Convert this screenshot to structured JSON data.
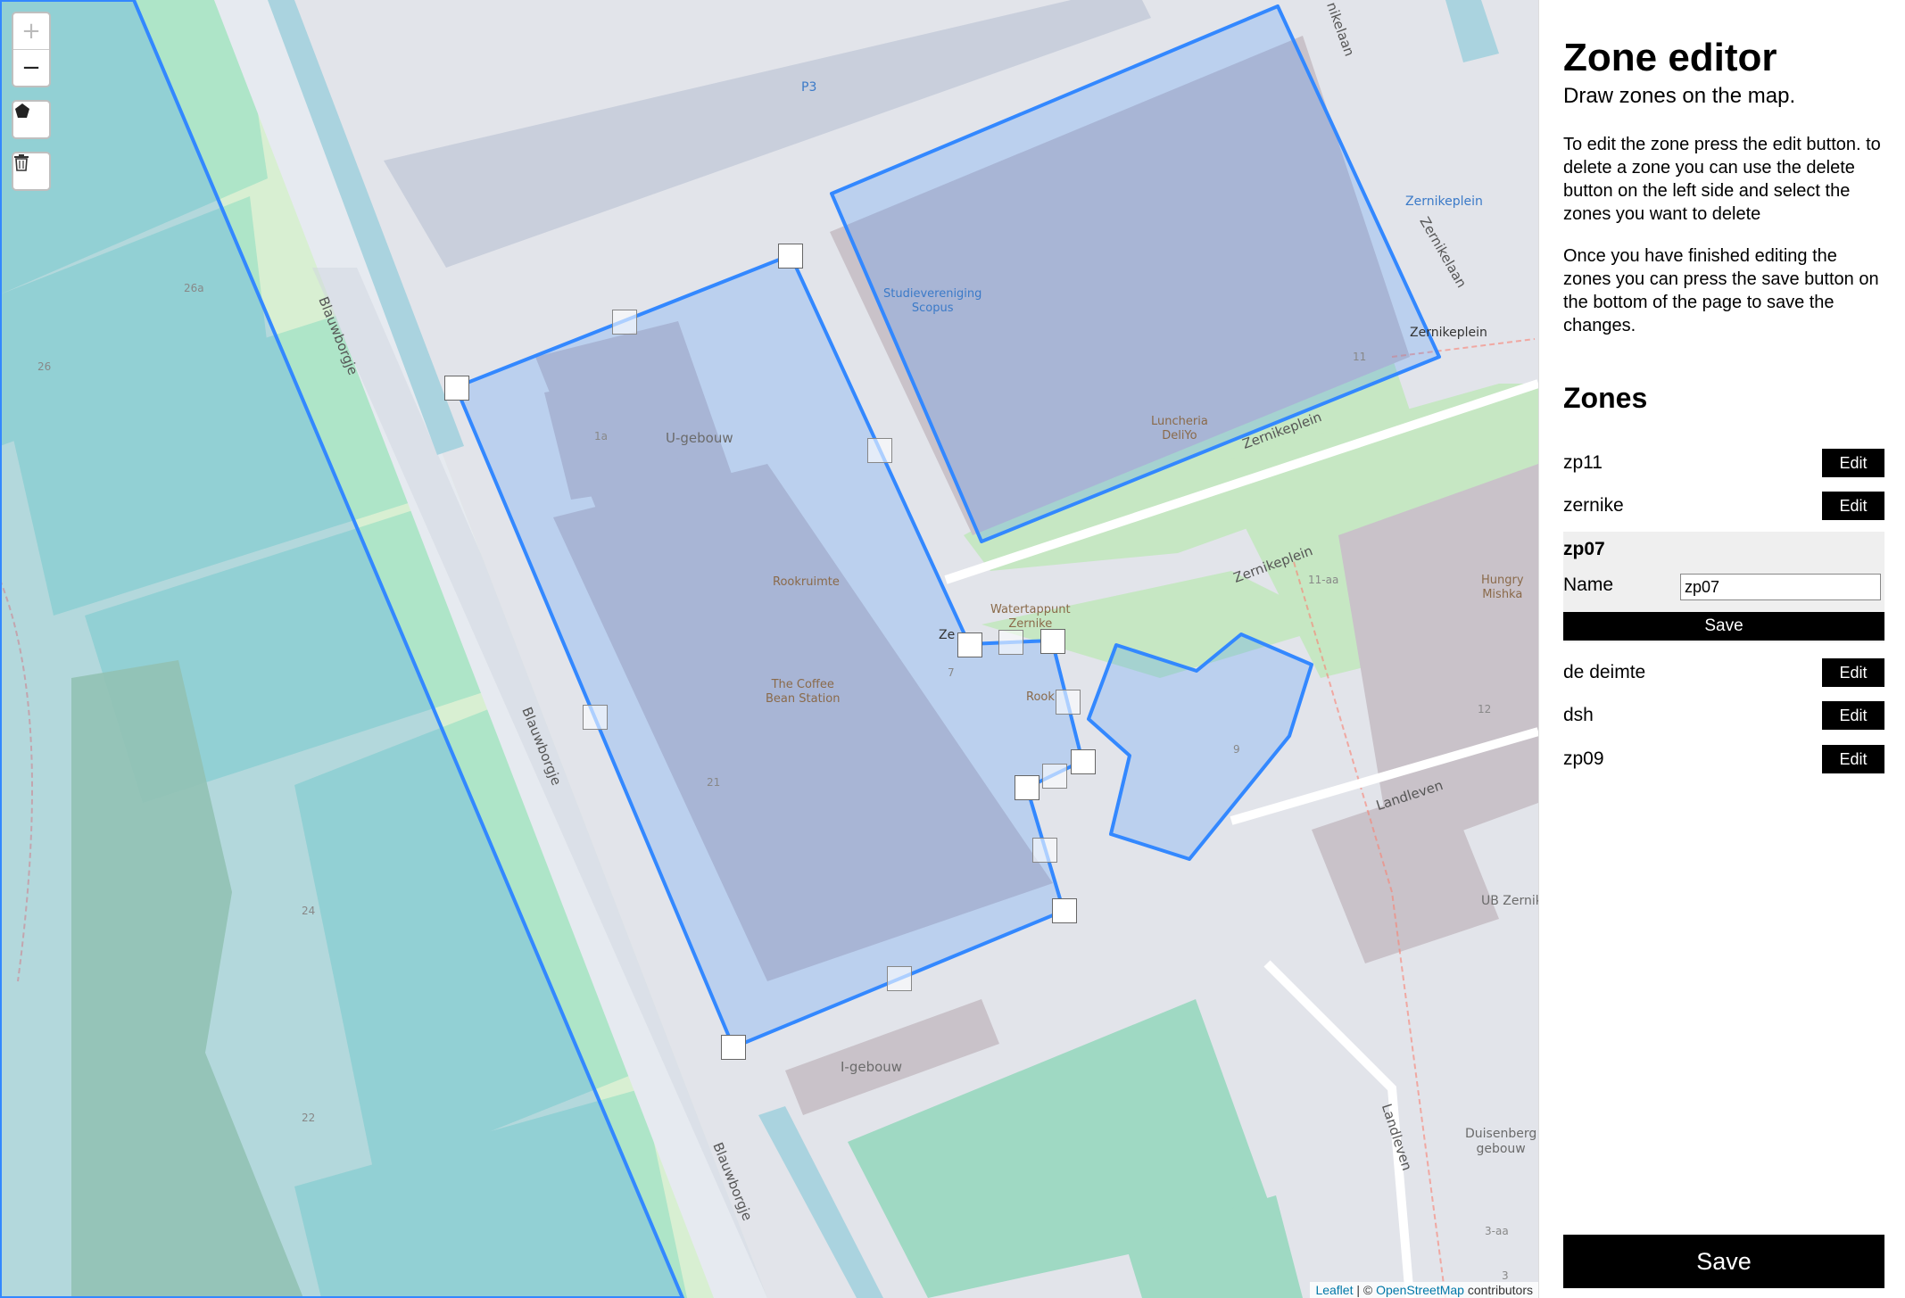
{
  "panel": {
    "title": "Zone editor",
    "subtitle": "Draw zones on the map.",
    "para1": "To edit the zone press the edit button. to delete a zone you can use the delete button on the left side and select the zones you want to delete",
    "para2": "Once you have finished editing the zones you can press the save button on the bottom of the page to save the changes.",
    "zones_heading": "Zones",
    "edit_label": "Edit",
    "zones": [
      "zp11",
      "zernike",
      "zp07",
      "de deimte",
      "dsh",
      "zp09"
    ],
    "editing": {
      "title": "zp07",
      "name_label": "Name",
      "name_value": "zp07",
      "save_label": "Save"
    },
    "save_label": "Save"
  },
  "map": {
    "zoom_in": "+",
    "zoom_out": "−",
    "draw_polygon_icon": "pentagon-icon",
    "delete_icon": "trash-icon",
    "attribution": {
      "leaflet": "Leaflet",
      "separator": " | © ",
      "osm": "OpenStreetMap",
      "suffix": " contributors"
    },
    "labels": {
      "p3": "P3",
      "blauwborgje1": "Blauwborgje",
      "blauwborgje2": "Blauwborgje",
      "blauwborgje3": "Blauwborgje",
      "ugebouw": "U-gebouw",
      "rookruimte": "Rookruimte",
      "coffeebean": "The Coffee\nBean Station",
      "studievereniging": "Studievereniging\nScopus",
      "luncheria": "Luncheria\nDeliYo",
      "watertappunt": "Watertappunt\nZernike",
      "zernikeplein1": "Zernikeplein",
      "zernikeplein2": "Zernikeplein",
      "zernikeplein3": "Zernikeplein",
      "zernikeplein4": "Zernikeplein",
      "zernikelaan": "Zernikelaan",
      "nikelaan": "nikelaan",
      "landleven1": "Landleven",
      "landleven2": "Landleven",
      "igebouw": "I-gebouw",
      "hungry": "Hungry\nMishka",
      "ubzernike": "UB Zernik",
      "duisenberg": "Duisenberg\ngebouw",
      "zepl": "Ze",
      "rook2": "Rook",
      "n26a": "26a",
      "n26": "26",
      "n24": "24",
      "n22": "22",
      "n1a": "1a",
      "n21": "21",
      "n7": "7",
      "n9": "9",
      "n11": "11",
      "n11aa": "11-aa",
      "n12": "12",
      "n3aa": "3-aa",
      "n3": "3"
    }
  }
}
